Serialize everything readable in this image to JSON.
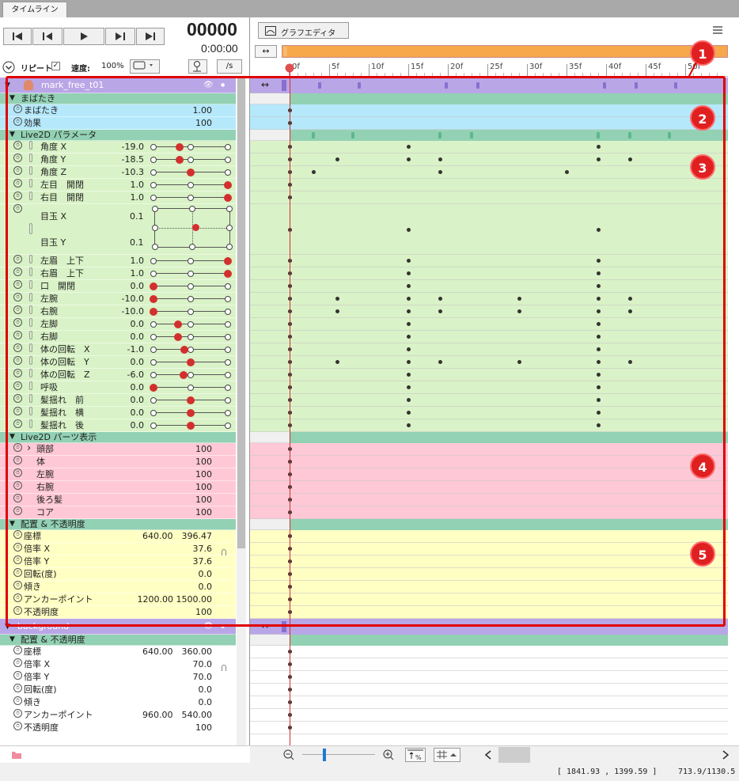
{
  "tab": "タイムライン",
  "frame": "00000",
  "time": "0:00:00",
  "graph": "グラフエディタ",
  "repeat": "リピート",
  "speed_label": "速度:",
  "speed": "100%",
  "fps_btn": "/s",
  "ruler": [
    "0f",
    "5f",
    "10f",
    "15f",
    "20f",
    "25f",
    "30f",
    "35f",
    "40f",
    "45f",
    "50f"
  ],
  "status_coords": "[ 1841.93 , 1399.59 ]",
  "status_size": "713.9/1130.5",
  "callouts": [
    "1",
    "2",
    "3",
    "4",
    "5"
  ],
  "colors": {
    "layer": "#b9a6e6",
    "section": "#92d1b3",
    "blink": "#b5e8fb",
    "param": "#d9f2c7",
    "parts": "#ffc8d6",
    "transform": "#ffffc4",
    "select": "#d32f2f"
  },
  "rows": [
    {
      "k": "layer",
      "name": "mark_free_t01"
    },
    {
      "k": "sec",
      "name": "まばたき"
    },
    {
      "k": "blink",
      "name": "まばたき",
      "v": "1.00"
    },
    {
      "k": "blink",
      "name": "効果",
      "v": "100"
    },
    {
      "k": "sec",
      "name": "Live2D パラメータ"
    },
    {
      "k": "param",
      "name": "角度 X",
      "v": "-19.0",
      "d": [
        0.35
      ],
      "kf": [
        0,
        15,
        39
      ]
    },
    {
      "k": "param",
      "name": "角度 Y",
      "v": "-18.5",
      "d": [
        0.35
      ],
      "kf": [
        0,
        6,
        15,
        19,
        39,
        43
      ]
    },
    {
      "k": "param",
      "name": "角度 Z",
      "v": "-10.3",
      "d": [
        0.5
      ],
      "kf": [
        0,
        3,
        19,
        35
      ]
    },
    {
      "k": "param",
      "name": "左目　開閉",
      "v": "1.0",
      "d": [
        1
      ],
      "kf": [
        0
      ]
    },
    {
      "k": "param",
      "name": "右目　開閉",
      "v": "1.0",
      "d": [
        1
      ],
      "kf": [
        0
      ]
    },
    {
      "k": "eye",
      "name": "目玉 X",
      "v": "0.1",
      "name2": "目玉 Y",
      "v2": "0.1",
      "kf": [
        0,
        15,
        39
      ]
    },
    {
      "k": "param",
      "name": "左眉　上下",
      "v": "1.0",
      "d": [
        1
      ],
      "kf": [
        0,
        15,
        39
      ]
    },
    {
      "k": "param",
      "name": "右眉　上下",
      "v": "1.0",
      "d": [
        1
      ],
      "kf": [
        0,
        15,
        39
      ]
    },
    {
      "k": "param",
      "name": "口　開閉",
      "v": "0.0",
      "d": [
        0
      ],
      "kf": [
        0,
        15,
        39
      ]
    },
    {
      "k": "param",
      "name": "左腕",
      "v": "-10.0",
      "d": [
        0
      ],
      "kf": [
        0,
        6,
        15,
        19,
        29,
        39,
        43
      ]
    },
    {
      "k": "param",
      "name": "右腕",
      "v": "-10.0",
      "d": [
        0
      ],
      "kf": [
        0,
        6,
        15,
        19,
        29,
        39,
        43
      ]
    },
    {
      "k": "param",
      "name": "左脚",
      "v": "0.0",
      "d": [
        0.33
      ],
      "kf": [
        0,
        15,
        39
      ]
    },
    {
      "k": "param",
      "name": "右脚",
      "v": "0.0",
      "d": [
        0.33
      ],
      "kf": [
        0,
        15,
        39
      ]
    },
    {
      "k": "param",
      "name": "体の回転　X",
      "v": "-1.0",
      "d": [
        0.42
      ],
      "kf": [
        0,
        15,
        39
      ]
    },
    {
      "k": "param",
      "name": "体の回転　Y",
      "v": "0.0",
      "d": [
        0.5
      ],
      "kf": [
        0,
        6,
        15,
        19,
        29,
        39,
        43
      ]
    },
    {
      "k": "param",
      "name": "体の回転　Z",
      "v": "-6.0",
      "d": [
        0.4
      ],
      "kf": [
        0,
        15,
        39
      ]
    },
    {
      "k": "param",
      "name": "呼吸",
      "v": "0.0",
      "d": [
        0
      ],
      "kf": [
        0,
        15,
        39
      ]
    },
    {
      "k": "param",
      "name": "髪揺れ　前",
      "v": "0.0",
      "d": [
        0.5
      ],
      "kf": [
        0,
        15,
        39
      ]
    },
    {
      "k": "param",
      "name": "髪揺れ　横",
      "v": "0.0",
      "d": [
        0.5
      ],
      "kf": [
        0,
        15,
        39
      ]
    },
    {
      "k": "param",
      "name": "髪揺れ　後",
      "v": "0.0",
      "d": [
        0.5
      ],
      "kf": [
        0,
        15,
        39
      ]
    },
    {
      "k": "sec",
      "name": "Live2D パーツ表示"
    },
    {
      "k": "parts",
      "name": "頭部",
      "v": "100",
      "arrow": true
    },
    {
      "k": "parts",
      "name": "体",
      "v": "100"
    },
    {
      "k": "parts",
      "name": "左腕",
      "v": "100"
    },
    {
      "k": "parts",
      "name": "右腕",
      "v": "100"
    },
    {
      "k": "parts",
      "name": "後ろ髪",
      "v": "100"
    },
    {
      "k": "parts",
      "name": "コア",
      "v": "100"
    },
    {
      "k": "sec",
      "name": "配置 & 不透明度"
    },
    {
      "k": "tf",
      "name": "座標",
      "v": "640.00　396.47"
    },
    {
      "k": "tf",
      "name": "倍率 X",
      "v": "37.6",
      "link": true
    },
    {
      "k": "tf",
      "name": "倍率 Y",
      "v": "37.6"
    },
    {
      "k": "tf",
      "name": "回転(度)",
      "v": "0.0"
    },
    {
      "k": "tf",
      "name": "傾き",
      "v": "0.0"
    },
    {
      "k": "tf",
      "name": "アンカーポイント",
      "v": "1200.00 1500.00"
    },
    {
      "k": "tf",
      "name": "不透明度",
      "v": "100"
    },
    {
      "k": "layer",
      "name": "background"
    },
    {
      "k": "sec",
      "name": "配置 & 不透明度"
    },
    {
      "k": "bg",
      "name": "座標",
      "v": "640.00　360.00"
    },
    {
      "k": "bg",
      "name": "倍率 X",
      "v": "70.0",
      "link": true
    },
    {
      "k": "bg",
      "name": "倍率 Y",
      "v": "70.0"
    },
    {
      "k": "bg",
      "name": "回転(度)",
      "v": "0.0"
    },
    {
      "k": "bg",
      "name": "傾き",
      "v": "0.0"
    },
    {
      "k": "bg",
      "name": "アンカーポイント",
      "v": "960.00　540.00"
    },
    {
      "k": "bg",
      "name": "不透明度",
      "v": "100"
    }
  ]
}
